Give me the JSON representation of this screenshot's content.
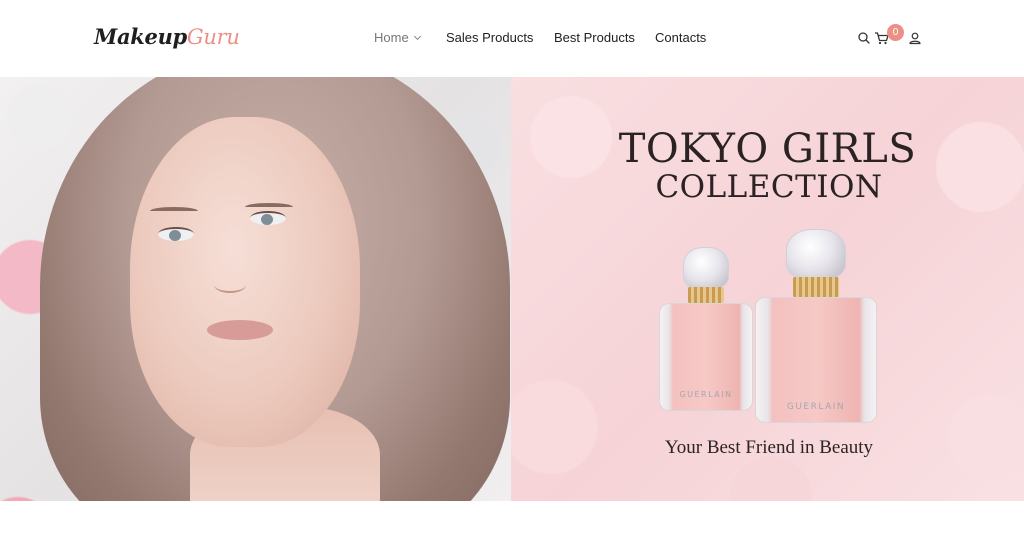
{
  "header": {
    "logo": {
      "part1": "Makeup",
      "part2": "Guru"
    },
    "nav": [
      {
        "label": "Home",
        "has_dropdown": true,
        "active": true
      },
      {
        "label": "Sales Products"
      },
      {
        "label": "Best Products"
      },
      {
        "label": "Contacts"
      }
    ],
    "tools": {
      "search_icon": "search-icon",
      "cart_icon": "cart-icon",
      "cart_count": "0",
      "account_icon": "user-icon"
    }
  },
  "hero": {
    "promo": {
      "title": "TOKYO GIRLS",
      "subtitle": "COLLECTION",
      "tagline": "Your Best Friend in Beauty",
      "bottle_label": "GUERLAIN"
    }
  },
  "colors": {
    "accent": "#ec8f86",
    "text_dark": "#222222",
    "hero_pink": "#f7d6da"
  }
}
